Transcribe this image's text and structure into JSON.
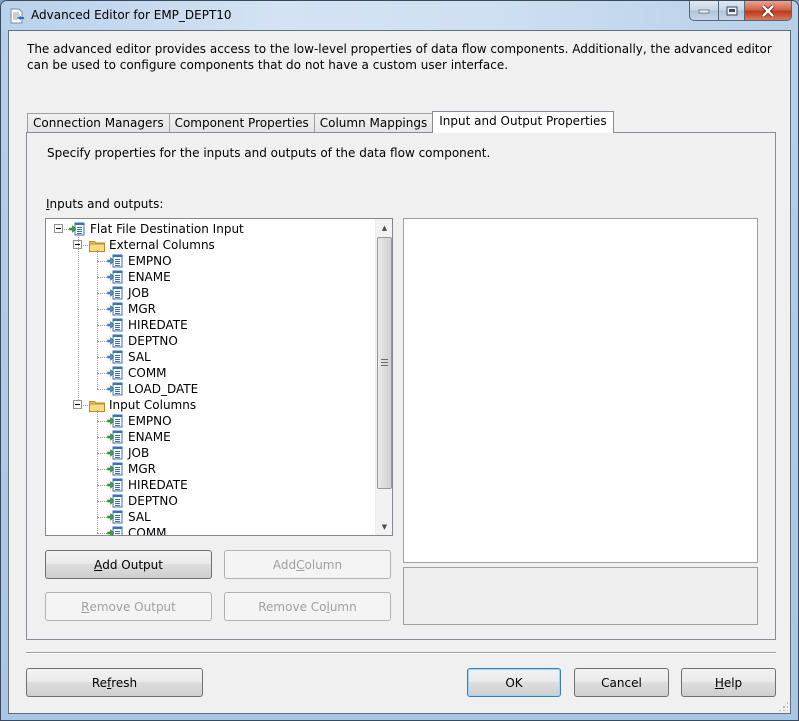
{
  "window": {
    "title": "Advanced Editor for EMP_DEPT10",
    "caption_buttons": {
      "minimize": "minimize-icon",
      "maximize": "maximize-icon",
      "close": "close-icon"
    }
  },
  "intro_text": "The advanced editor provides access to the low-level properties of data flow components. Additionally, the advanced editor can be used to configure components that do not have a custom user interface.",
  "tabs": [
    {
      "label": "Connection Managers",
      "active": false
    },
    {
      "label": "Component Properties",
      "active": false
    },
    {
      "label": "Column Mappings",
      "active": false
    },
    {
      "label": "Input and Output Properties",
      "active": true
    }
  ],
  "panel": {
    "description": "Specify properties for the inputs and outputs of the data flow component.",
    "io_label_mnemonic": "I",
    "io_label_rest": "nputs and outputs:"
  },
  "tree": {
    "root": {
      "label": "Flat File Destination Input",
      "icon": "input-icon",
      "expanded": true
    },
    "groups": [
      {
        "label": "External Columns",
        "icon": "folder-icon",
        "expanded": true,
        "item_icon": "external-column-icon",
        "items": [
          "EMPNO",
          "ENAME",
          "JOB",
          "MGR",
          "HIREDATE",
          "DEPTNO",
          "SAL",
          "COMM",
          "LOAD_DATE"
        ]
      },
      {
        "label": "Input Columns",
        "icon": "folder-icon",
        "expanded": true,
        "item_icon": "input-column-icon",
        "items": [
          "EMPNO",
          "ENAME",
          "JOB",
          "MGR",
          "HIREDATE",
          "DEPTNO",
          "SAL",
          "COMM"
        ]
      }
    ]
  },
  "buttons": {
    "add_output": {
      "pre": "",
      "mn": "A",
      "post": "dd Output",
      "enabled": true
    },
    "add_column": {
      "pre": "Add ",
      "mn": "C",
      "post": "olumn",
      "enabled": false
    },
    "remove_output": {
      "pre": "",
      "mn": "R",
      "post": "emove Output",
      "enabled": false
    },
    "remove_column": {
      "pre": "Remove Co",
      "mn": "l",
      "post": "umn",
      "enabled": false
    },
    "refresh": {
      "pre": "Re",
      "mn": "f",
      "post": "resh"
    },
    "ok": {
      "label": "OK"
    },
    "cancel": {
      "label": "Cancel"
    },
    "help": {
      "pre": "",
      "mn": "H",
      "post": "elp"
    }
  }
}
